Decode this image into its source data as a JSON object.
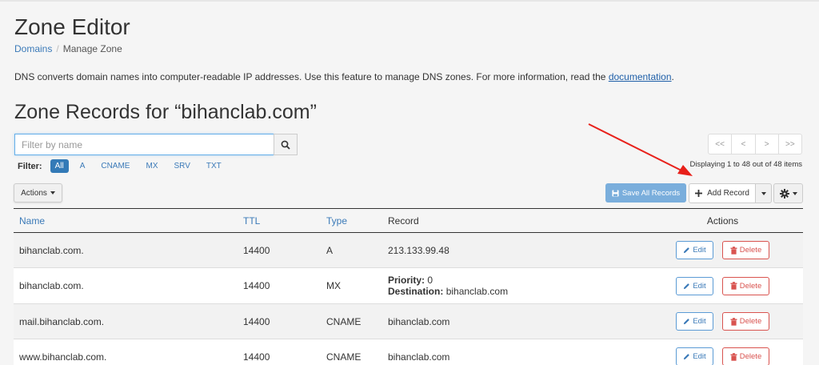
{
  "page": {
    "title": "Zone Editor",
    "breadcrumb": [
      {
        "label": "Domains"
      },
      {
        "label": "Manage Zone"
      }
    ],
    "description": "DNS converts domain names into computer-readable IP addresses. Use this feature to manage DNS zones. For more information, read the ",
    "description_link": "documentation",
    "description_end": ".",
    "zone_heading": "Zone Records for “bihanclab.com”"
  },
  "search": {
    "placeholder": "Filter by name",
    "value": ""
  },
  "filter": {
    "label": "Filter:",
    "options": [
      "All",
      "A",
      "CNAME",
      "MX",
      "SRV",
      "TXT"
    ],
    "active": "All"
  },
  "pager": {
    "first": "<<",
    "prev": "<",
    "next": ">",
    "last": ">>"
  },
  "displaying": "Displaying 1 to 48 out of 48 items",
  "toolbar": {
    "actions_label": "Actions",
    "save_all_label": "Save All Records",
    "add_record_label": "Add Record"
  },
  "table": {
    "headers": {
      "name": "Name",
      "ttl": "TTL",
      "type": "Type",
      "record": "Record",
      "actions": "Actions"
    },
    "edit_label": "Edit",
    "delete_label": "Delete",
    "rows": [
      {
        "name": "bihanclab.com.",
        "ttl": "14400",
        "type": "A",
        "record": "213.133.99.48"
      },
      {
        "name": "bihanclab.com.",
        "ttl": "14400",
        "type": "MX",
        "priority_label": "Priority:",
        "priority": "0",
        "destination_label": "Destination:",
        "destination": "bihanclab.com"
      },
      {
        "name": "mail.bihanclab.com.",
        "ttl": "14400",
        "type": "CNAME",
        "record": "bihanclab.com"
      },
      {
        "name": "www.bihanclab.com.",
        "ttl": "14400",
        "type": "CNAME",
        "record": "bihanclab.com"
      }
    ]
  },
  "colors": {
    "accent": "#337ab7",
    "annotation_arrow": "#e8201a",
    "danger": "#d9534f"
  },
  "icons": [
    "search-icon",
    "floppy-disk-icon",
    "plus-icon",
    "gear-icon",
    "pencil-icon",
    "trash-icon"
  ]
}
